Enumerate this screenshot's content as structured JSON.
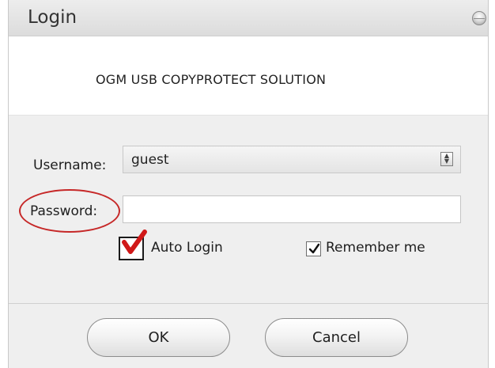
{
  "window": {
    "title": "Login"
  },
  "banner": {
    "text": "OGM USB COPYPROTECT SOLUTION"
  },
  "form": {
    "username_label": "Username:",
    "username_value": "guest",
    "password_label": "Password:",
    "password_value": "",
    "auto_login_label": "Auto Login",
    "remember_label": "Remember me"
  },
  "buttons": {
    "ok_label": "OK",
    "cancel_label": "Cancel"
  },
  "states": {
    "auto_login_checked": true,
    "remember_me_checked": true
  },
  "icons": {
    "close": "close-icon",
    "select_arrow": "up-down-icon",
    "auto_login_check": "checkmark-icon",
    "remember_check": "checkmark-icon"
  },
  "colors": {
    "annotation_red": "#c62828"
  }
}
